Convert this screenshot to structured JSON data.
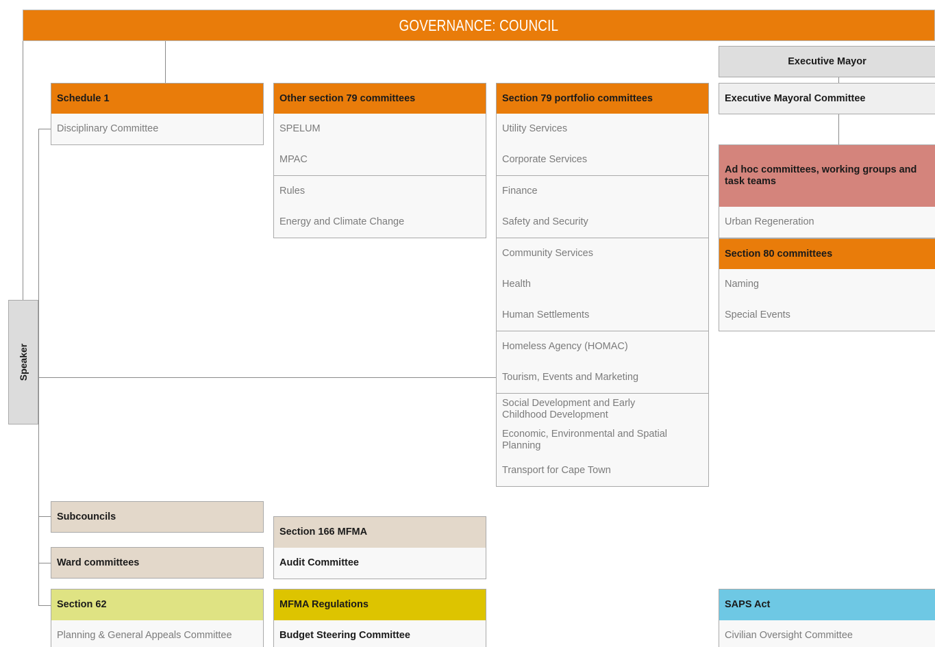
{
  "title": "GOVERNANCE: COUNCIL",
  "speaker": "Speaker",
  "schedule1": {
    "header": "Schedule 1",
    "items": [
      "Disciplinary Committee"
    ]
  },
  "other79": {
    "header": "Other section 79 committees",
    "items": [
      "SPELUM",
      "MPAC",
      "Rules",
      "Energy and Climate Change"
    ]
  },
  "portfolio79": {
    "header": "Section 79 portfolio committees",
    "items": [
      "Utility Services",
      "Corporate Services",
      "Finance",
      "Safety and Security",
      "Community Services",
      "Health",
      "Human Settlements",
      "Homeless Agency (HOMAC)",
      "Tourism, Events and Marketing",
      "Social Development and Early Childhood Development",
      "Economic, Environmental and Spatial Planning",
      "Transport for Cape Town"
    ]
  },
  "executive": {
    "mayor": "Executive Mayor",
    "committee": "Executive Mayoral Committee",
    "adhoc_header": "Ad hoc committees, working groups and task teams",
    "adhoc_items": [
      "Urban Regeneration"
    ],
    "s80_header": "Section 80 committees",
    "s80_items": [
      "Naming",
      "Special Events"
    ]
  },
  "subcouncils": "Subcouncils",
  "ward_committees": "Ward committees",
  "s166": {
    "header": "Section 166 MFMA",
    "items": [
      "Audit Committee"
    ]
  },
  "s62": {
    "header": "Section 62",
    "items": [
      "Planning & General Appeals Committee"
    ]
  },
  "mfma_regs": {
    "header": "MFMA Regulations",
    "items": [
      "Budget Steering Committee"
    ]
  },
  "saps": {
    "header": "SAPS Act",
    "items": [
      "Civilian Oversight Committee"
    ]
  },
  "colors": {
    "orange": "#e97c0a",
    "beige": "#e3d8ca",
    "lime": "#dfe383",
    "mustard": "#ddc400",
    "sky": "#6ec8e4",
    "rose": "#d4847c",
    "grey": "#dedede"
  }
}
